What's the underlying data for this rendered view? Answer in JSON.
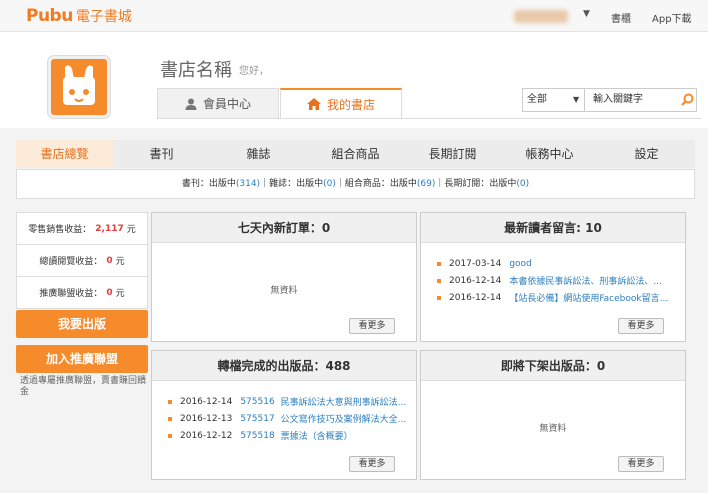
{
  "brand": {
    "logo_text": "Pubu",
    "logo_cn": "電子書城"
  },
  "topbar": {
    "bookshelf": "書櫃",
    "app_download": "App下載"
  },
  "store": {
    "name": "書店名稱",
    "greeting": "您好，"
  },
  "tabs": [
    {
      "label": "會員中心",
      "icon": "person-icon"
    },
    {
      "label": "我的書店",
      "icon": "home-icon",
      "active": true
    }
  ],
  "search": {
    "scope": "全部",
    "placeholder": "輸入關鍵字"
  },
  "nav": [
    {
      "label": "書店總覽",
      "active": true
    },
    {
      "label": "書刊"
    },
    {
      "label": "雜誌"
    },
    {
      "label": "組合商品"
    },
    {
      "label": "長期訂閱"
    },
    {
      "label": "帳務中心"
    },
    {
      "label": "設定"
    }
  ],
  "published": {
    "book_label": "書刊：出版中",
    "book_count": "(314)",
    "mag_label": "雜誌：出版中",
    "mag_count": "(0)",
    "bundle_label": "組合商品：出版中",
    "bundle_count": "(69)",
    "sub_label": "長期訂閱：出版中",
    "sub_count": "(0)",
    "sep": "｜"
  },
  "stats": [
    {
      "label": "零售銷售收益：",
      "value": "2,117",
      "unit": "元"
    },
    {
      "label": "總讀閱覽收益：",
      "value": "0",
      "unit": "元"
    },
    {
      "label": "推廣聯盟收益：",
      "value": "0",
      "unit": "元"
    }
  ],
  "buttons": {
    "publish": "我要出版",
    "join_promo": "加入推廣聯盟"
  },
  "promo_note": "透過專屬推廣聯盟，賣書賺回饋金",
  "panels": {
    "orders": {
      "title": "七天內新訂單：0",
      "empty": "無資料",
      "more": "看更多"
    },
    "messages": {
      "title": "最新讀者留言: 10",
      "more": "看更多",
      "items": [
        {
          "date": "2017-03-14",
          "text": "good"
        },
        {
          "date": "2016-12-14",
          "text": "本書依據民事訴訟法、刑事訴訟法、..."
        },
        {
          "date": "2016-12-14",
          "text": "【站長必備】網站使用Facebook留言..."
        }
      ]
    },
    "converted": {
      "title": "轉檔完成的出版品：488",
      "more": "看更多",
      "items": [
        {
          "date": "2016-12-14",
          "code": "575516",
          "text": "民事訴訟法大意與刑事訴訟法..."
        },
        {
          "date": "2016-12-13",
          "code": "575517",
          "text": "公文寫作技巧及案例解法大全..."
        },
        {
          "date": "2016-12-12",
          "code": "575518",
          "text": "票據法（含概要）"
        }
      ]
    },
    "removing": {
      "title": "即將下架出版品：0",
      "empty": "無資料",
      "more": "看更多"
    }
  },
  "colors": {
    "accent": "#f68b2c",
    "link": "#2b7fc0",
    "value": "#e03c3c"
  }
}
